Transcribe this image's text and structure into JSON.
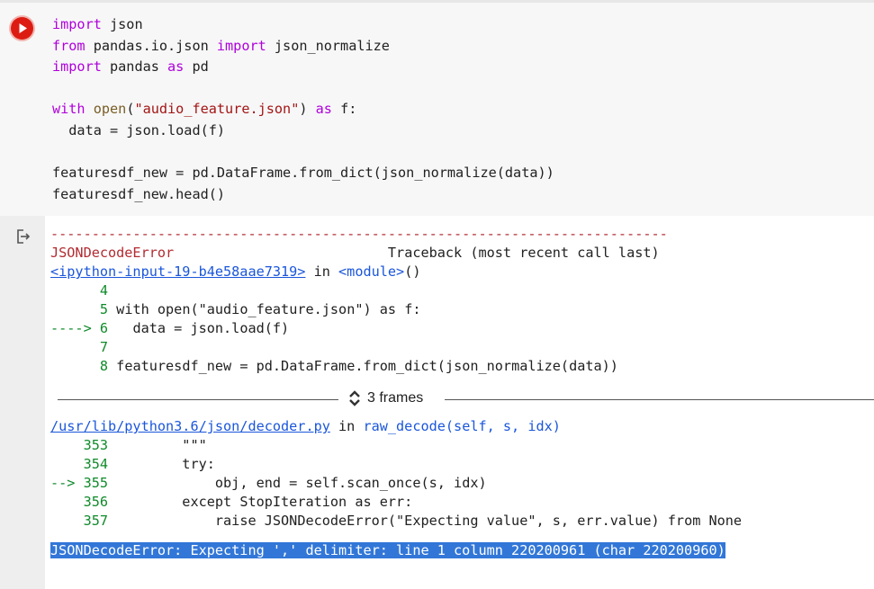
{
  "code_cell": {
    "run_button_label": "Run cell",
    "code_lines": [
      "import json",
      "from pandas.io.json import json_normalize",
      "import pandas as pd",
      "",
      "with open(\"audio_feature.json\") as f:",
      "  data = json.load(f)",
      "",
      "featuresdf_new = pd.DataFrame.from_dict(json_normalize(data))",
      "featuresdf_new.head()"
    ]
  },
  "output": {
    "separator": "---------------------------------------------------------------------------",
    "error_name": "JSONDecodeError",
    "traceback_header": "Traceback (most recent call last)",
    "frame1": {
      "file_link": "<ipython-input-19-b4e58aae7319>",
      "in_text": " in ",
      "func": "<module>",
      "func_suffix": "()",
      "lines": [
        {
          "arrow": "      ",
          "num": "4",
          "code": ""
        },
        {
          "arrow": "      ",
          "num": "5",
          "code": " with open(\"audio_feature.json\") as f:"
        },
        {
          "arrow": "----> ",
          "num": "6",
          "code": "   data = json.load(f)"
        },
        {
          "arrow": "      ",
          "num": "7",
          "code": ""
        },
        {
          "arrow": "      ",
          "num": "8",
          "code": " featuresdf_new = pd.DataFrame.from_dict(json_normalize(data))"
        }
      ]
    },
    "frames_toggle_label": "3 frames",
    "frame2": {
      "file_link": "/usr/lib/python3.6/json/decoder.py",
      "in_text": " in ",
      "func": "raw_decode(self, s, idx)",
      "lines": [
        {
          "arrow": "    ",
          "num": "353",
          "code": "         \"\"\""
        },
        {
          "arrow": "    ",
          "num": "354",
          "code": "         try:"
        },
        {
          "arrow": "--> ",
          "num": "355",
          "code": "             obj, end = self.scan_once(s, idx)"
        },
        {
          "arrow": "    ",
          "num": "356",
          "code": "         except StopIteration as err:"
        },
        {
          "arrow": "    ",
          "num": "357",
          "code": "             raise JSONDecodeError(\"Expecting value\", s, err.value) from None"
        }
      ]
    },
    "final_error": "JSONDecodeError: Expecting ',' delimiter: line 1 column 220200961 (char 220200960)"
  },
  "colors": {
    "run_button": "#dc1c13",
    "error_red": "#b22b31",
    "line_number_green": "#0f8a2a",
    "link_blue": "#1a56db",
    "selection": "#3277d8"
  },
  "icons": {
    "run": "play-circle-icon",
    "output": "output-redirect-icon",
    "frames": "unfold-icon"
  }
}
